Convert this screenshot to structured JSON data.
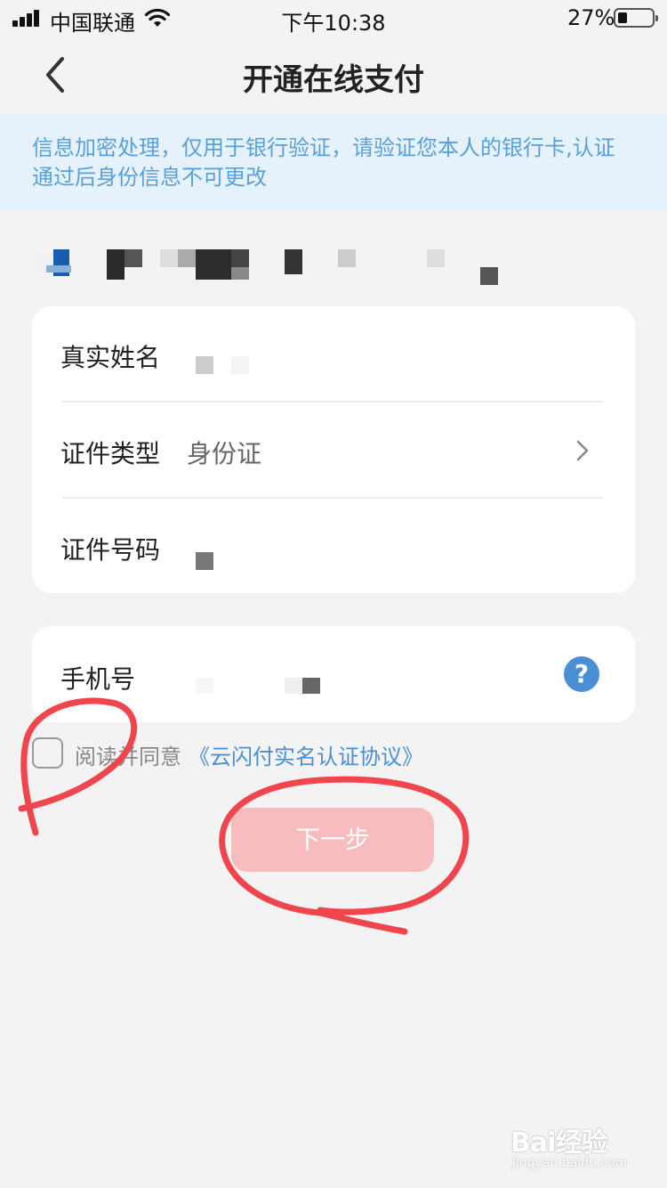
{
  "status_bar": {
    "carrier": "中国联通",
    "time": "下午10:38",
    "battery": "27%"
  },
  "nav": {
    "title": "开通在线支付",
    "back_icon": "chevron-left-icon"
  },
  "notice": "信息加密处理，仅用于银行验证，请验证您本人的银行卡,认证通过后身份信息不可更改",
  "form": {
    "real_name_label": "真实姓名",
    "id_type_label": "证件类型",
    "id_type_value": "身份证",
    "id_number_label": "证件号码",
    "phone_label": "手机号"
  },
  "agreement": {
    "text": "阅读并同意",
    "link": "《云闪付实名认证协议》"
  },
  "next_button": "下一步",
  "watermark": {
    "main": "Bai经验",
    "sub": "jingyan.baidu.com"
  },
  "colors": {
    "accent_blue": "#4a8fd4",
    "notice_bg": "#e6f2fb",
    "button_pink": "#f8bcbf",
    "annotation_red": "#f0454c"
  }
}
